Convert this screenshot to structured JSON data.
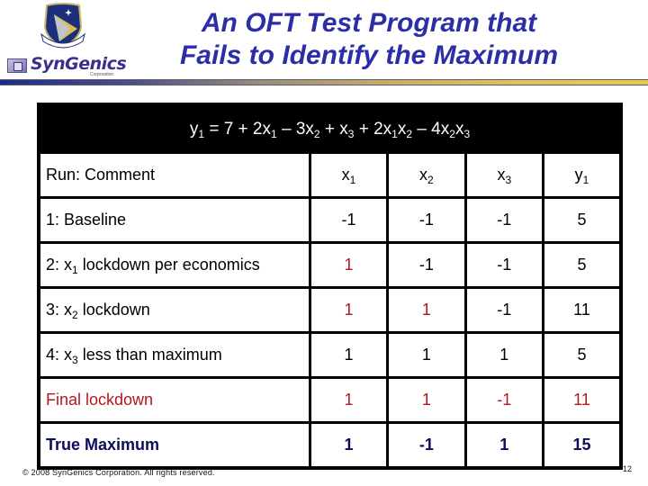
{
  "header": {
    "title_line1": "An OFT Test Program that",
    "title_line2": "Fails to Identify the Maximum",
    "logo_text": "SynGenics",
    "logo_subtext": "Corporation",
    "emblem": "shield-emblem-icon",
    "colors": {
      "title": "#2b2ea6",
      "rule_start": "#1b2b8c",
      "rule_end": "#e9c84e"
    }
  },
  "formula": {
    "lhs": "y",
    "lhs_sub": "1",
    "parts": [
      {
        "t": " = 7 + 2x",
        "s": "1"
      },
      {
        "t": " – 3x",
        "s": "2"
      },
      {
        "t": " + x",
        "s": "3"
      },
      {
        "t": " + 2x",
        "s": "1"
      },
      {
        "t": "x",
        "s": "2"
      },
      {
        "t": " – 4x",
        "s": "2"
      },
      {
        "t": "x",
        "s": "3"
      }
    ]
  },
  "table": {
    "headers": [
      {
        "text": "Run: Comment"
      },
      {
        "base": "x",
        "sub": "1"
      },
      {
        "base": "x",
        "sub": "2"
      },
      {
        "base": "x",
        "sub": "3"
      },
      {
        "base": "y",
        "sub": "1"
      }
    ],
    "rows": [
      {
        "label_pre": "1: Baseline",
        "label_sub": "",
        "label_post": "",
        "style": "normal",
        "cells": [
          {
            "v": "-1",
            "c": "normal"
          },
          {
            "v": "-1",
            "c": "normal"
          },
          {
            "v": "-1",
            "c": "normal"
          },
          {
            "v": "5",
            "c": "normal"
          }
        ]
      },
      {
        "label_pre": "2: x",
        "label_sub": "1",
        "label_post": " lockdown per economics",
        "style": "normal",
        "cells": [
          {
            "v": "1",
            "c": "red"
          },
          {
            "v": "-1",
            "c": "normal"
          },
          {
            "v": "-1",
            "c": "normal"
          },
          {
            "v": "5",
            "c": "normal"
          }
        ]
      },
      {
        "label_pre": "3: x",
        "label_sub": "2",
        "label_post": " lockdown",
        "style": "normal",
        "cells": [
          {
            "v": "1",
            "c": "red"
          },
          {
            "v": "1",
            "c": "red"
          },
          {
            "v": "-1",
            "c": "normal"
          },
          {
            "v": "11",
            "c": "normal"
          }
        ]
      },
      {
        "label_pre": "4: x",
        "label_sub": "3",
        "label_post": " less than maximum",
        "style": "normal",
        "cells": [
          {
            "v": "1",
            "c": "normal"
          },
          {
            "v": "1",
            "c": "normal"
          },
          {
            "v": "1",
            "c": "normal"
          },
          {
            "v": "5",
            "c": "normal"
          }
        ]
      },
      {
        "label_pre": "Final lockdown",
        "label_sub": "",
        "label_post": "",
        "style": "red",
        "cells": [
          {
            "v": "1",
            "c": "red"
          },
          {
            "v": "1",
            "c": "red"
          },
          {
            "v": "-1",
            "c": "red"
          },
          {
            "v": "11",
            "c": "red"
          }
        ]
      },
      {
        "label_pre": "True Maximum",
        "label_sub": "",
        "label_post": "",
        "style": "navy",
        "cells": [
          {
            "v": "1",
            "c": "navy"
          },
          {
            "v": "-1",
            "c": "navy"
          },
          {
            "v": "1",
            "c": "navy"
          },
          {
            "v": "15",
            "c": "navy"
          }
        ]
      }
    ],
    "colors": {
      "red": "#b3171d",
      "navy": "#0c0c5a"
    }
  },
  "footer": {
    "copyright": "© 2008 SynGenics Corporation. All rights reserved.",
    "page_number": "12"
  }
}
